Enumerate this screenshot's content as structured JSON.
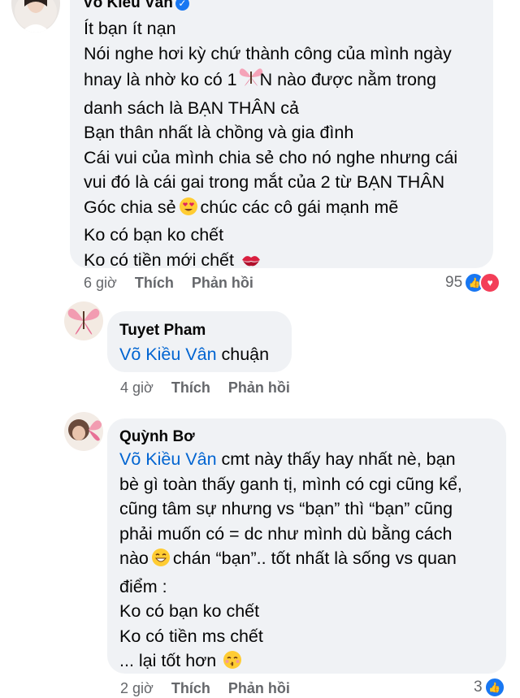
{
  "comments": [
    {
      "author": "Võ Kiều Vân",
      "verified": true,
      "lines": [
        "Ít bạn ít nạn",
        "Nói nghe hơi kỳ chứ thành công của mình ngày",
        "hnay là nhờ ko có 1 ",
        "N nào được nằm trong",
        "danh sách là BẠN THÂN cả",
        "Bạn thân nhất là chồng và gia đình",
        "Cái vui của mình chia sẻ cho nó nghe nhưng cái",
        "vui đó là cái gai trong mắt của 2 từ BẠN THÂN",
        "Góc chia sẻ",
        "chúc các cô gái mạnh mẽ",
        "Ko có bạn ko chết",
        "Ko có tiền mới chết"
      ],
      "time": "6 giờ",
      "like_label": "Thích",
      "reply_label": "Phản hồi",
      "reactions_count": "95",
      "emojis": [
        "butterfly-emoji",
        "heart-eyes-emoji",
        "kiss-mark-emoji"
      ]
    },
    {
      "author": "Tuyet Pham",
      "mention": "Võ Kiều Vân",
      "text": " chuận",
      "time": "4 giờ",
      "like_label": "Thích",
      "reply_label": "Phản hồi"
    },
    {
      "author": "Quỳnh Bơ",
      "mention": "Võ Kiều Vân",
      "first_line": " cmt này thấy hay nhất nè, bạn",
      "lines": [
        "bè gì toàn thấy ganh tị, mình có cgi cũng kể,",
        "cũng tâm sự nhưng vs “bạn” thì “bạn” cũng",
        "phải muốn có = dc như mình dù bằng cách",
        "nào",
        "chán “bạn”.. tốt nhất là sống vs quan",
        "điểm :",
        "Ko có bạn ko chết",
        "Ko có tiền ms chết",
        "... lại tốt hơn"
      ],
      "time": "2 giờ",
      "like_label": "Thích",
      "reply_label": "Phản hồi",
      "reactions_count": "3",
      "emojis": [
        "grinning-emoji",
        "kissing-smiling-eyes-emoji"
      ]
    }
  ]
}
